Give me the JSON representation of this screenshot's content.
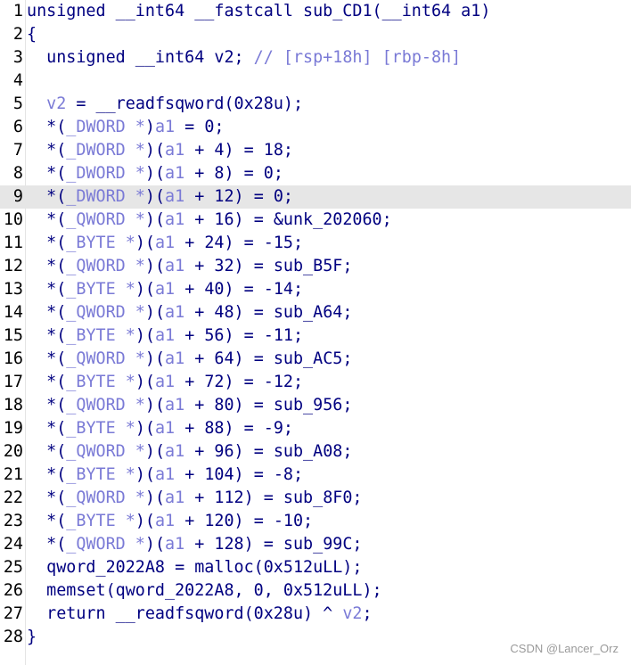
{
  "highlighted_line": 9,
  "lines": [
    {
      "n": "1",
      "segs": [
        {
          "t": "unsigned __int64 __fastcall sub_CD1(__int64 a1)",
          "c": "pl"
        }
      ]
    },
    {
      "n": "2",
      "segs": [
        {
          "t": "{",
          "c": "pl"
        }
      ]
    },
    {
      "n": "3",
      "segs": [
        {
          "t": "  unsigned __int64 v2; ",
          "c": "pl"
        },
        {
          "t": "// [rsp+18h] [rbp-8h]",
          "c": "cm"
        }
      ]
    },
    {
      "n": "4",
      "segs": [
        {
          "t": "",
          "c": "pl"
        }
      ]
    },
    {
      "n": "5",
      "segs": [
        {
          "t": "  ",
          "c": "pl"
        },
        {
          "t": "v2",
          "c": "var"
        },
        {
          "t": " = __readfsqword(0x28u);",
          "c": "pl"
        }
      ]
    },
    {
      "n": "6",
      "segs": [
        {
          "t": "  *(",
          "c": "pl"
        },
        {
          "t": "_DWORD *",
          "c": "typ"
        },
        {
          "t": ")",
          "c": "pl"
        },
        {
          "t": "a1",
          "c": "var"
        },
        {
          "t": " = 0;",
          "c": "pl"
        }
      ]
    },
    {
      "n": "7",
      "segs": [
        {
          "t": "  *(",
          "c": "pl"
        },
        {
          "t": "_DWORD *",
          "c": "typ"
        },
        {
          "t": ")(",
          "c": "pl"
        },
        {
          "t": "a1",
          "c": "var"
        },
        {
          "t": " + 4) = 18;",
          "c": "pl"
        }
      ]
    },
    {
      "n": "8",
      "segs": [
        {
          "t": "  *(",
          "c": "pl"
        },
        {
          "t": "_DWORD *",
          "c": "typ"
        },
        {
          "t": ")(",
          "c": "pl"
        },
        {
          "t": "a1",
          "c": "var"
        },
        {
          "t": " + 8) = 0;",
          "c": "pl"
        }
      ]
    },
    {
      "n": "9",
      "segs": [
        {
          "t": "  *(",
          "c": "pl"
        },
        {
          "t": "_DWORD *",
          "c": "typ"
        },
        {
          "t": ")(",
          "c": "pl"
        },
        {
          "t": "a1",
          "c": "var"
        },
        {
          "t": " + 12) = 0;",
          "c": "pl"
        }
      ]
    },
    {
      "n": "10",
      "segs": [
        {
          "t": "  *(",
          "c": "pl"
        },
        {
          "t": "_QWORD *",
          "c": "typ"
        },
        {
          "t": ")(",
          "c": "pl"
        },
        {
          "t": "a1",
          "c": "var"
        },
        {
          "t": " + 16) = &unk_202060;",
          "c": "pl"
        }
      ]
    },
    {
      "n": "11",
      "segs": [
        {
          "t": "  *(",
          "c": "pl"
        },
        {
          "t": "_BYTE *",
          "c": "typ"
        },
        {
          "t": ")(",
          "c": "pl"
        },
        {
          "t": "a1",
          "c": "var"
        },
        {
          "t": " + 24) = -15;",
          "c": "pl"
        }
      ]
    },
    {
      "n": "12",
      "segs": [
        {
          "t": "  *(",
          "c": "pl"
        },
        {
          "t": "_QWORD *",
          "c": "typ"
        },
        {
          "t": ")(",
          "c": "pl"
        },
        {
          "t": "a1",
          "c": "var"
        },
        {
          "t": " + 32) = sub_B5F;",
          "c": "pl"
        }
      ]
    },
    {
      "n": "13",
      "segs": [
        {
          "t": "  *(",
          "c": "pl"
        },
        {
          "t": "_BYTE *",
          "c": "typ"
        },
        {
          "t": ")(",
          "c": "pl"
        },
        {
          "t": "a1",
          "c": "var"
        },
        {
          "t": " + 40) = -14;",
          "c": "pl"
        }
      ]
    },
    {
      "n": "14",
      "segs": [
        {
          "t": "  *(",
          "c": "pl"
        },
        {
          "t": "_QWORD *",
          "c": "typ"
        },
        {
          "t": ")(",
          "c": "pl"
        },
        {
          "t": "a1",
          "c": "var"
        },
        {
          "t": " + 48) = sub_A64;",
          "c": "pl"
        }
      ]
    },
    {
      "n": "15",
      "segs": [
        {
          "t": "  *(",
          "c": "pl"
        },
        {
          "t": "_BYTE *",
          "c": "typ"
        },
        {
          "t": ")(",
          "c": "pl"
        },
        {
          "t": "a1",
          "c": "var"
        },
        {
          "t": " + 56) = -11;",
          "c": "pl"
        }
      ]
    },
    {
      "n": "16",
      "segs": [
        {
          "t": "  *(",
          "c": "pl"
        },
        {
          "t": "_QWORD *",
          "c": "typ"
        },
        {
          "t": ")(",
          "c": "pl"
        },
        {
          "t": "a1",
          "c": "var"
        },
        {
          "t": " + 64) = sub_AC5;",
          "c": "pl"
        }
      ]
    },
    {
      "n": "17",
      "segs": [
        {
          "t": "  *(",
          "c": "pl"
        },
        {
          "t": "_BYTE *",
          "c": "typ"
        },
        {
          "t": ")(",
          "c": "pl"
        },
        {
          "t": "a1",
          "c": "var"
        },
        {
          "t": " + 72) = -12;",
          "c": "pl"
        }
      ]
    },
    {
      "n": "18",
      "segs": [
        {
          "t": "  *(",
          "c": "pl"
        },
        {
          "t": "_QWORD *",
          "c": "typ"
        },
        {
          "t": ")(",
          "c": "pl"
        },
        {
          "t": "a1",
          "c": "var"
        },
        {
          "t": " + 80) = sub_956;",
          "c": "pl"
        }
      ]
    },
    {
      "n": "19",
      "segs": [
        {
          "t": "  *(",
          "c": "pl"
        },
        {
          "t": "_BYTE *",
          "c": "typ"
        },
        {
          "t": ")(",
          "c": "pl"
        },
        {
          "t": "a1",
          "c": "var"
        },
        {
          "t": " + 88) = -9;",
          "c": "pl"
        }
      ]
    },
    {
      "n": "20",
      "segs": [
        {
          "t": "  *(",
          "c": "pl"
        },
        {
          "t": "_QWORD *",
          "c": "typ"
        },
        {
          "t": ")(",
          "c": "pl"
        },
        {
          "t": "a1",
          "c": "var"
        },
        {
          "t": " + 96) = sub_A08;",
          "c": "pl"
        }
      ]
    },
    {
      "n": "21",
      "segs": [
        {
          "t": "  *(",
          "c": "pl"
        },
        {
          "t": "_BYTE *",
          "c": "typ"
        },
        {
          "t": ")(",
          "c": "pl"
        },
        {
          "t": "a1",
          "c": "var"
        },
        {
          "t": " + 104) = -8;",
          "c": "pl"
        }
      ]
    },
    {
      "n": "22",
      "segs": [
        {
          "t": "  *(",
          "c": "pl"
        },
        {
          "t": "_QWORD *",
          "c": "typ"
        },
        {
          "t": ")(",
          "c": "pl"
        },
        {
          "t": "a1",
          "c": "var"
        },
        {
          "t": " + 112) = sub_8F0;",
          "c": "pl"
        }
      ]
    },
    {
      "n": "23",
      "segs": [
        {
          "t": "  *(",
          "c": "pl"
        },
        {
          "t": "_BYTE *",
          "c": "typ"
        },
        {
          "t": ")(",
          "c": "pl"
        },
        {
          "t": "a1",
          "c": "var"
        },
        {
          "t": " + 120) = -10;",
          "c": "pl"
        }
      ]
    },
    {
      "n": "24",
      "segs": [
        {
          "t": "  *(",
          "c": "pl"
        },
        {
          "t": "_QWORD *",
          "c": "typ"
        },
        {
          "t": ")(",
          "c": "pl"
        },
        {
          "t": "a1",
          "c": "var"
        },
        {
          "t": " + 128) = sub_99C;",
          "c": "pl"
        }
      ]
    },
    {
      "n": "25",
      "segs": [
        {
          "t": "  qword_2022A8 = malloc(0x512uLL);",
          "c": "pl"
        }
      ]
    },
    {
      "n": "26",
      "segs": [
        {
          "t": "  memset(qword_2022A8, 0, 0x512uLL);",
          "c": "pl"
        }
      ]
    },
    {
      "n": "27",
      "segs": [
        {
          "t": "  return __readfsqword(0x28u) ^ ",
          "c": "pl"
        },
        {
          "t": "v2",
          "c": "var"
        },
        {
          "t": ";",
          "c": "pl"
        }
      ]
    },
    {
      "n": "28",
      "segs": [
        {
          "t": "}",
          "c": "pl"
        }
      ]
    }
  ],
  "watermark": "CSDN @Lancer_Orz",
  "colors": {
    "plain": "#000080",
    "variable": "#7a7ad6",
    "comment": "#7a7ad6",
    "highlight_bg": "#e6e6e6"
  }
}
